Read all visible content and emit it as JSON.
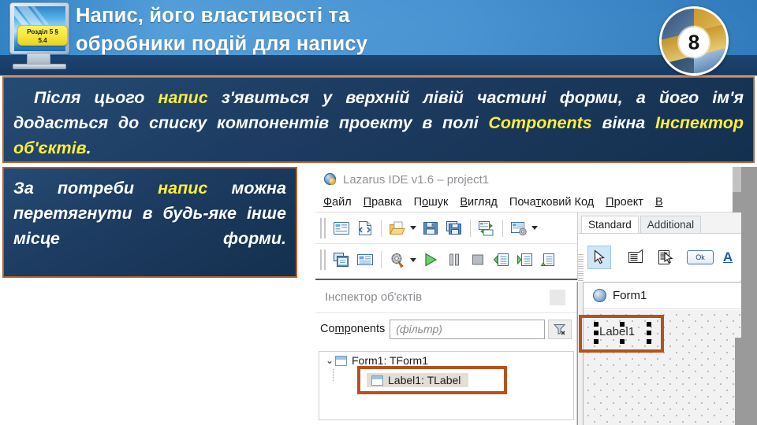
{
  "slide": {
    "title": "Напис, його властивості та\nобробники подій для напису",
    "logo_tag": "Розділ 5 §\n5.4",
    "badge_number": "8",
    "colors": {
      "header_blue": "#4a93d2",
      "header_dark": "#1d4470",
      "callout_bg": "#1d3c61",
      "callout_border": "#b5622f",
      "highlight_text": "#ffee3a",
      "selection_orange": "#b5521f"
    }
  },
  "callout_top": {
    "p1": "Після цього ",
    "hl1": "напис",
    "p2": " з'явиться у верхній лівій частині",
    "p3": "форми, а його ім'я додасться до списку компонентів",
    "p4": "проекту в полі ",
    "hl2": "Components",
    "p5": " вікна ",
    "hl3": "Інспектор об'єктів",
    "p6": "."
  },
  "callout_left": {
    "p1": "За потреби ",
    "hl1": "напис",
    "p2": "можна перетягнути в",
    "p3": "будь-яке інше місце",
    "p4": "форми."
  },
  "ide": {
    "title": "Lazarus IDE v1.6 – project1",
    "menu": [
      "Файл",
      "Правка",
      "Пошук",
      "Вигляд",
      "Початковий Код",
      "Проект",
      "В"
    ],
    "menu_mnemonics": [
      "Ф",
      "П",
      "о",
      "В",
      "ч",
      "П",
      "В"
    ],
    "toolbar_row1": [
      "new-unit-icon",
      "new-form-icon",
      "open-file-icon",
      "open-dropdown-caret",
      "save-icon",
      "save-all-icon",
      "toggle-form-unit-icon",
      "view-units-icon",
      "view-dropdown-caret"
    ],
    "toolbar_row2": [
      "view-forms-icon",
      "view-unit-info-icon",
      "build-icon",
      "build-dropdown-caret",
      "run-icon",
      "pause-icon",
      "stop-icon",
      "step-into-icon",
      "step-over-icon",
      "step-out-icon"
    ],
    "palette": {
      "tabs": [
        {
          "label": "Standard",
          "active": true
        },
        {
          "label": "Additional",
          "active": false
        }
      ],
      "items": [
        {
          "name": "selection-arrow-tool",
          "selected": true
        },
        {
          "name": "tframe-icon",
          "selected": false
        },
        {
          "name": "tmainmenu-icon",
          "selected": false
        },
        {
          "name": "tbutton-icon",
          "label": "Ok",
          "selected": false
        },
        {
          "name": "tlabel-icon",
          "label": "A",
          "selected": false
        }
      ]
    },
    "object_inspector": {
      "title": "Інспектор об'єктів",
      "components_label": "Components",
      "filter_placeholder": "(фільтр)",
      "tree": [
        {
          "label": "Form1: TForm1",
          "level": 0,
          "expanded": true,
          "selected": false
        },
        {
          "label": "Label1: TLabel",
          "level": 1,
          "expanded": false,
          "selected": true
        }
      ]
    },
    "designer": {
      "form_caption": "Form1",
      "label_text": "Label1",
      "label_selected": true
    }
  }
}
